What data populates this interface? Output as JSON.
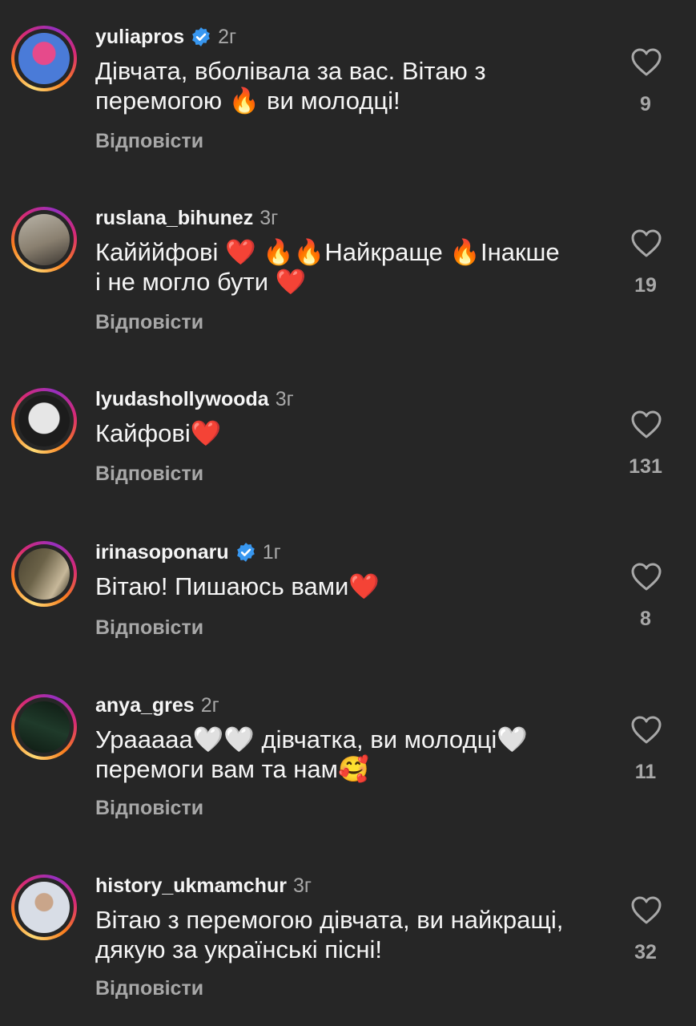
{
  "comments": [
    {
      "username": "yuliapros",
      "verified": true,
      "time": "2г",
      "text": "Дівчата, вболівала за вас. Вітаю з\nперемогою 🔥 ви молодці!",
      "reply_label": "Відповісти",
      "likes": "9",
      "avatar_colors": [
        "#4a7bd8",
        "#e64a8b"
      ]
    },
    {
      "username": "ruslana_bihunez",
      "verified": false,
      "time": "3г",
      "text": "Кайййфові ❤️ 🔥🔥Найкраще 🔥Інакше\nі не могло бути ❤️",
      "reply_label": "Відповісти",
      "likes": "19",
      "avatar_colors": [
        "#8a8070",
        "#b9b4a8"
      ]
    },
    {
      "username": "lyudashollywooda",
      "verified": false,
      "time": "3г",
      "text": "Кайфові❤️",
      "reply_label": "Відповісти",
      "likes": "131",
      "avatar_colors": [
        "#e6e6e6",
        "#1c1c1c"
      ]
    },
    {
      "username": "irinasoponaru",
      "verified": true,
      "time": "1г",
      "text": "Вітаю! Пишаюсь вами❤️",
      "reply_label": "Відповісти",
      "likes": "8",
      "avatar_colors": [
        "#4a4330",
        "#c7b89a"
      ]
    },
    {
      "username": "anya_gres",
      "verified": false,
      "time": "2г",
      "text": "Урааааа🤍🤍 дівчатка, ви молодці🤍\nперемоги вам та нам🥰",
      "reply_label": "Відповісти",
      "likes": "11",
      "avatar_colors": [
        "#1f3a2a",
        "#0e1a12"
      ]
    },
    {
      "username": "history_ukmamchur",
      "verified": false,
      "time": "3г",
      "text": "Вітаю з перемогою дівчата, ви найкращі,\nдякую за українські пісні!",
      "reply_label": "Відповісти",
      "likes": "32",
      "avatar_colors": [
        "#d8dde6",
        "#6b5a4a"
      ]
    }
  ],
  "colors": {
    "background": "#262626",
    "text": "#f5f5f5",
    "muted": "#a8a8a8",
    "verified": "#3897f0"
  }
}
